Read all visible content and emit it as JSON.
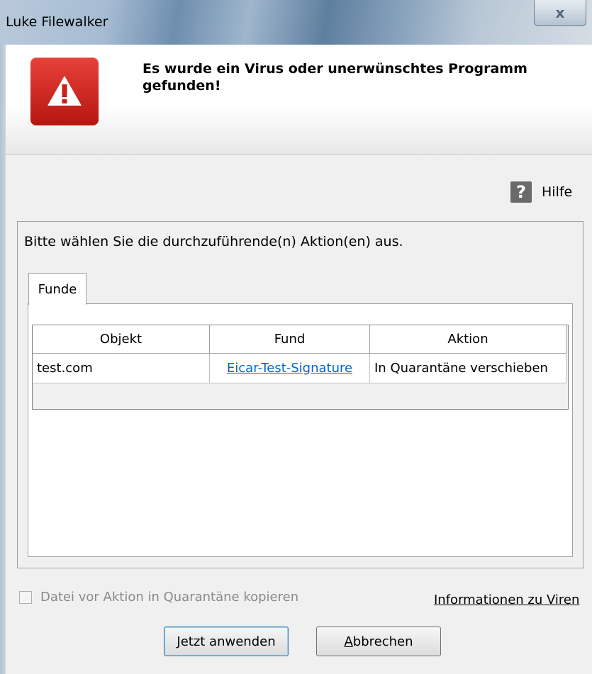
{
  "window": {
    "title": "Luke Filewalker",
    "close_glyph": "x"
  },
  "header": {
    "icon": "warning-icon",
    "headline": "Es wurde ein Virus oder unerwünschtes Programm gefunden!",
    "accent_color": "#c8201b"
  },
  "help": {
    "icon": "help-icon",
    "glyph": "?",
    "label": "Hilfe"
  },
  "main": {
    "instruction": "Bitte wählen Sie die durchzuführende(n) Aktion(en) aus.",
    "tabs": [
      {
        "label": "Funde"
      }
    ],
    "table": {
      "columns": [
        "Objekt",
        "Fund",
        "Aktion"
      ],
      "rows": [
        {
          "object": "test.com",
          "finding": "Eicar-Test-Signature",
          "action": "In Quarantäne verschieben"
        }
      ]
    }
  },
  "footer": {
    "checkbox_label": "Datei vor Aktion in Quarantäne kopieren",
    "info_link": "Informationen zu Viren",
    "apply_button": {
      "mnemonic": "J",
      "rest": "etzt anwenden"
    },
    "cancel_button": {
      "mnemonic": "A",
      "rest": "bbrechen"
    }
  }
}
